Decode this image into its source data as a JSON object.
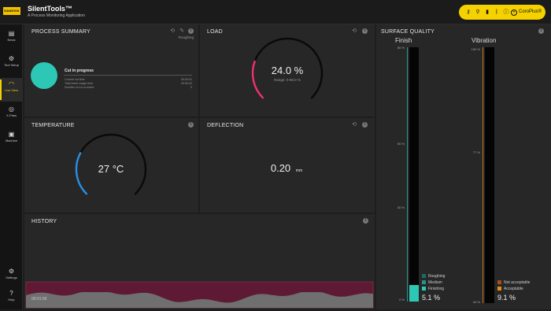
{
  "app": {
    "logo": "SANDVIK",
    "title": "SilentTools™",
    "subtitle": "A Process Monitoring Application"
  },
  "topbar": {
    "coroplus_label": "CoroPlus®",
    "icons": [
      "tool-icon",
      "tool-alt-icon",
      "battery-icon",
      "bluetooth-icon",
      "info-icon",
      "coroplus-icon"
    ]
  },
  "sidebar": {
    "items": [
      {
        "label": "News",
        "icon": "news-icon"
      },
      {
        "label": "Tool Setup",
        "icon": "tool-setup-icon"
      },
      {
        "label": "Live View",
        "icon": "gauge-icon",
        "active": true
      },
      {
        "label": "X-Pass",
        "icon": "target-icon"
      },
      {
        "label": "Machine",
        "icon": "machine-icon"
      }
    ],
    "bottom": [
      {
        "label": "Settings",
        "icon": "gear-icon"
      },
      {
        "label": "Help",
        "icon": "help-icon"
      }
    ]
  },
  "process_summary": {
    "title": "PROCESS SUMMARY",
    "mode": "Roughing",
    "status": "Cut in progress",
    "status_color": "#2cc8b5",
    "rows": [
      {
        "label": "Current cut time",
        "value": "00:00:01"
      },
      {
        "label": "Total insert usage time",
        "value": "00:00:02"
      },
      {
        "label": "Number of cut on insert",
        "value": "3"
      }
    ]
  },
  "load": {
    "title": "LOAD",
    "value": "24.0 %",
    "range": "Range: 0-98.0 %",
    "fraction": 0.24,
    "color": "#e8336b"
  },
  "temperature": {
    "title": "TEMPERATURE",
    "value": "27 °C",
    "fraction": 0.27,
    "color": "#2a8fe0"
  },
  "deflection": {
    "title": "DEFLECTION",
    "value": "0.20",
    "unit": "mm"
  },
  "history": {
    "title": "HISTORY",
    "time": "00:01:00",
    "series_color": "#7a1f3f"
  },
  "surface_quality": {
    "title": "SURFACE QUALITY",
    "finish": {
      "label": "Finish",
      "ticks": [
        "80 %",
        "50 %",
        "30 %",
        "0 %"
      ],
      "value": "5.1 %",
      "fraction": 0.064,
      "color": "#2cc8b5",
      "legend": [
        {
          "label": "Roughing",
          "color": "#1e6b62"
        },
        {
          "label": "Medium",
          "color": "#239488"
        },
        {
          "label": "Finishing",
          "color": "#2cc8b5"
        }
      ]
    },
    "vibration": {
      "label": "Vibration",
      "ticks": [
        "100 %",
        "77 %",
        "44 %"
      ],
      "value": "9.1 %",
      "fraction": 0.0,
      "color": "#e88a1a",
      "legend": [
        {
          "label": "Not acceptable",
          "color": "#a2521a"
        },
        {
          "label": "Acceptable",
          "color": "#e88a1a"
        }
      ]
    }
  }
}
